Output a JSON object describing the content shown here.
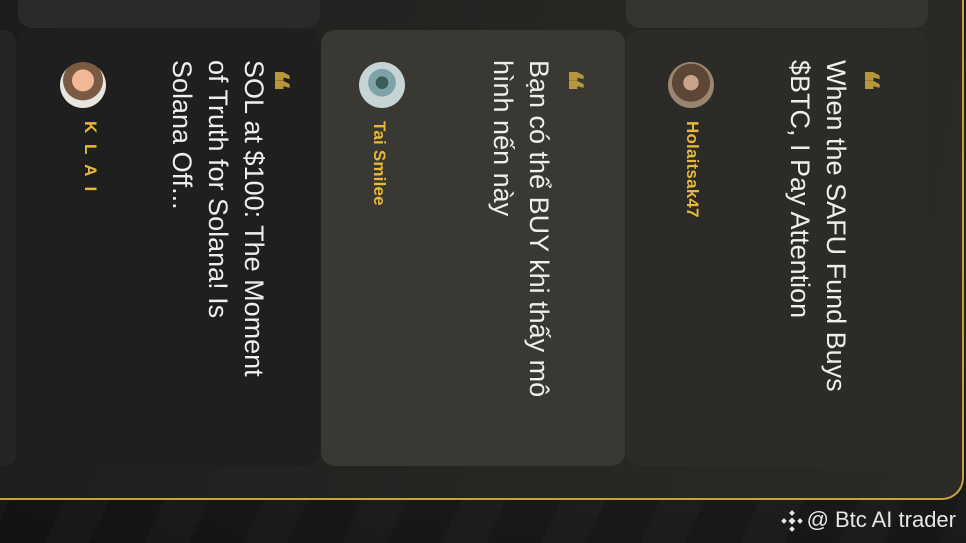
{
  "cards": [
    {
      "author": "K L A I",
      "text": "SOL at $100: The Moment of Truth for Solana! Is Solana Off..."
    },
    {
      "author": "Tai Smilee",
      "text": "Bạn có thể BUY khi thấy mô hình nến này"
    },
    {
      "author": "Holaitsak47",
      "text": "When the SAFU Fund Buys $BTC, I Pay Attention"
    }
  ],
  "quote_mark": "❝",
  "footer": {
    "prefix": "@",
    "name": "Btc AI trader"
  },
  "colors": {
    "accent": "#e7b83a",
    "border": "#c8a33c",
    "quote": "#b8963a"
  }
}
